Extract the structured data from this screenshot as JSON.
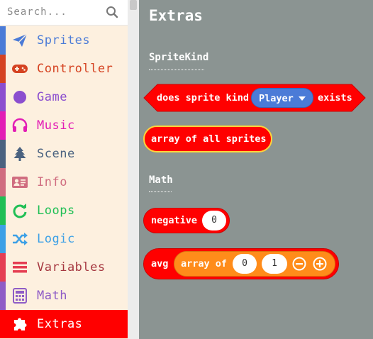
{
  "search": {
    "placeholder": "Search..."
  },
  "categories": [
    {
      "label": "Sprites",
      "icon": "paper-plane-icon",
      "color": "#4b7bd7"
    },
    {
      "label": "Controller",
      "icon": "gamepad-icon",
      "color": "#d54322"
    },
    {
      "label": "Game",
      "icon": "circle-icon",
      "color": "#8b4ecf"
    },
    {
      "label": "Music",
      "icon": "headphones-icon",
      "color": "#e21db5"
    },
    {
      "label": "Scene",
      "icon": "tree-icon",
      "color": "#4b6280"
    },
    {
      "label": "Info",
      "icon": "id-card-icon",
      "color": "#d06d80"
    },
    {
      "label": "Loops",
      "icon": "refresh-icon",
      "color": "#20bf55"
    },
    {
      "label": "Logic",
      "icon": "shuffle-icon",
      "color": "#3da0e6"
    },
    {
      "label": "Variables",
      "icon": "list-icon",
      "color": "#e53e52"
    },
    {
      "label": "Math",
      "icon": "calculator-icon",
      "color": "#8f5cc6"
    },
    {
      "label": "Extras",
      "icon": "puzzle-icon",
      "color": "#ff0000",
      "selected": true
    }
  ],
  "flyout": {
    "title": "Extras",
    "sections": {
      "spritekind": "SpriteKind",
      "math": "Math"
    },
    "blocks": {
      "sprite_kind_exists": {
        "prefix": "does sprite kind",
        "dropdown": "Player",
        "suffix": "exists"
      },
      "all_sprites": {
        "label": "array of all sprites"
      },
      "negative": {
        "label": "negative",
        "value": "0"
      },
      "avg": {
        "label": "avg",
        "inner_label": "array of",
        "values": [
          "0",
          "1"
        ]
      }
    },
    "colors": {
      "block": "#ff0000",
      "array": "#ff8c1a",
      "dropdown": "#4b7bd7",
      "background": "#8b9492"
    }
  }
}
